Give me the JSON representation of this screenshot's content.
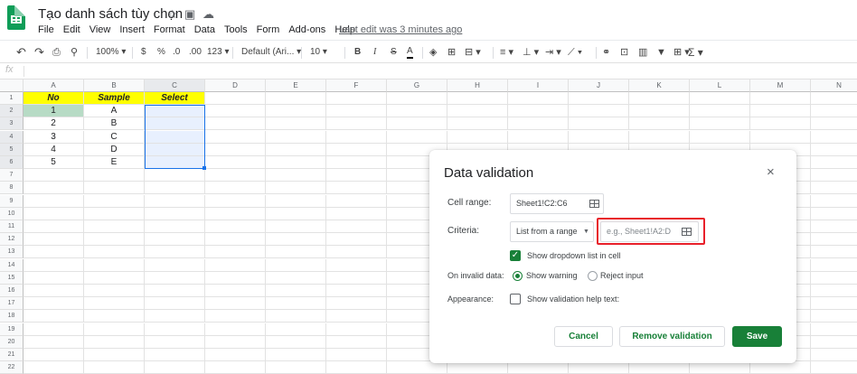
{
  "app": {
    "title": "Tạo danh sách tùy chọn",
    "last_edit": "Last edit was 3 minutes ago"
  },
  "menu": [
    "File",
    "Edit",
    "View",
    "Insert",
    "Format",
    "Data",
    "Tools",
    "Form",
    "Add-ons",
    "Help"
  ],
  "toolbar": {
    "zoom": "100%",
    "currency": "$",
    "percent": "%",
    "dec_minus": ".0",
    "dec_plus": ".00",
    "more_formats": "123",
    "font": "Default (Ari...",
    "font_size": "10",
    "bold": "B",
    "italic": "I",
    "strike": "S",
    "text_color": "A",
    "functions": "Σ"
  },
  "formula_bar": {
    "label": "fx"
  },
  "columns": [
    "A",
    "B",
    "C",
    "D",
    "E",
    "F",
    "G",
    "H",
    "I",
    "J",
    "K",
    "L",
    "M",
    "N"
  ],
  "rows": [
    "1",
    "2",
    "3",
    "4",
    "5",
    "6",
    "7",
    "8",
    "9",
    "10",
    "11",
    "12",
    "13",
    "14",
    "15",
    "16",
    "17",
    "18",
    "19",
    "20",
    "21",
    "22"
  ],
  "sheet": {
    "headers": [
      "No",
      "Sample",
      "Select"
    ],
    "data": [
      [
        "1",
        "A",
        ""
      ],
      [
        "2",
        "B",
        ""
      ],
      [
        "3",
        "C",
        ""
      ],
      [
        "4",
        "D",
        ""
      ],
      [
        "5",
        "E",
        ""
      ]
    ]
  },
  "dialog": {
    "title": "Data validation",
    "cell_range_label": "Cell range:",
    "cell_range_value": "Sheet1!C2:C6",
    "criteria_label": "Criteria:",
    "criteria_value": "List from a range",
    "criteria_placeholder": "e.g., Sheet1!A2:D",
    "show_dropdown_label": "Show dropdown list in cell",
    "invalid_label": "On invalid data:",
    "show_warning": "Show warning",
    "reject_input": "Reject input",
    "appearance_label": "Appearance:",
    "help_text_label": "Show validation help text:",
    "cancel": "Cancel",
    "remove": "Remove validation",
    "save": "Save"
  },
  "colors": {
    "accent": "#188038",
    "highlight": "#e8202a",
    "header_fill": "#ffff00",
    "selection": "#1a73e8"
  }
}
